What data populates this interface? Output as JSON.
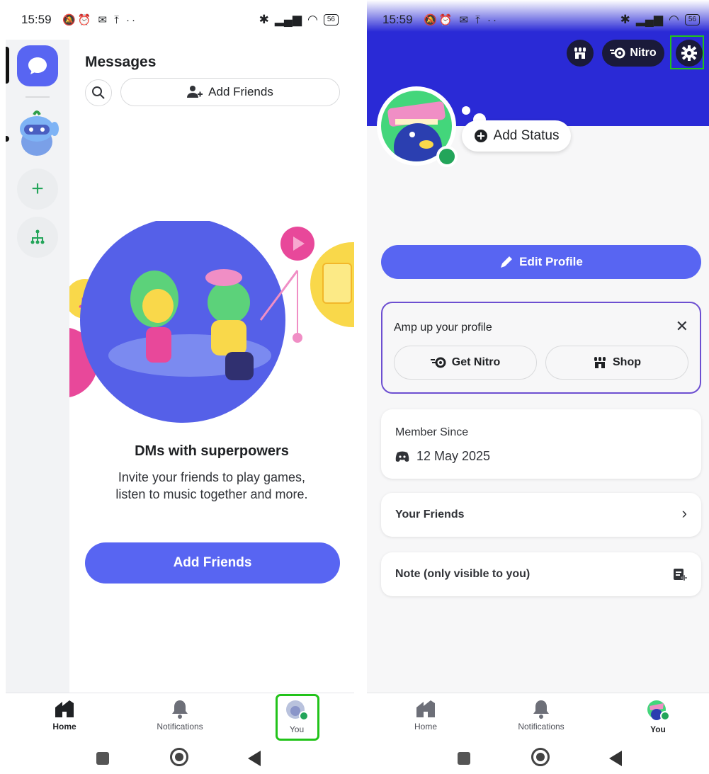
{
  "left": {
    "status_time": "15:59",
    "battery": "56",
    "messages_title": "Messages",
    "add_friends_top": "Add Friends",
    "dm_title": "DMs with superpowers",
    "dm_desc": "Invite your friends to play games, listen to music together and more.",
    "add_friends_big": "Add Friends",
    "nav": [
      {
        "label": "Home",
        "icon": "home-icon"
      },
      {
        "label": "Notifications",
        "icon": "bell-icon"
      },
      {
        "label": "You",
        "icon": "avatar"
      }
    ]
  },
  "right": {
    "status_time": "15:59",
    "battery": "56",
    "nitro_label": "Nitro",
    "add_status": "Add Status",
    "edit_profile": "Edit Profile",
    "amp_title": "Amp up your profile",
    "get_nitro": "Get Nitro",
    "shop": "Shop",
    "member_since_label": "Member Since",
    "member_since_value": "12 May 2025",
    "your_friends": "Your Friends",
    "note_label": "Note (only visible to you)",
    "nav": [
      {
        "label": "Home",
        "icon": "home-icon"
      },
      {
        "label": "Notifications",
        "icon": "bell-icon"
      },
      {
        "label": "You",
        "icon": "avatar"
      }
    ]
  },
  "colors": {
    "blurple": "#5865f2",
    "green": "#23a55a",
    "highlight": "#22c31a",
    "banner": "#2a2ad6"
  }
}
